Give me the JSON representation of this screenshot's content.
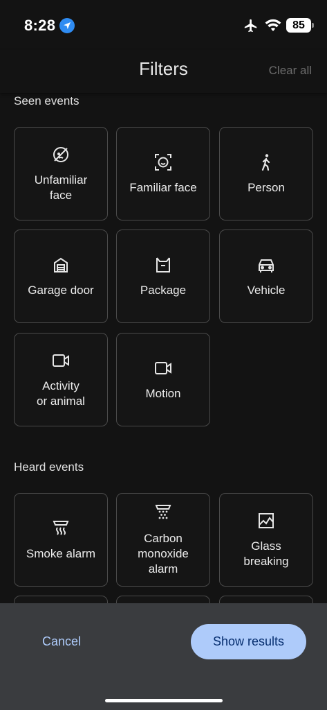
{
  "status": {
    "time": "8:28",
    "battery": "85",
    "icons": [
      "location-icon",
      "airplane-icon",
      "wifi-icon",
      "battery-icon"
    ]
  },
  "header": {
    "title": "Filters",
    "clear_all": "Clear all"
  },
  "seen": {
    "title": "Seen events",
    "items": [
      {
        "label": "Unfamiliar\nface",
        "icon": "unfamiliar-face-icon"
      },
      {
        "label": "Familiar face",
        "icon": "familiar-face-icon"
      },
      {
        "label": "Person",
        "icon": "person-walking-icon"
      },
      {
        "label": "Garage door",
        "icon": "garage-icon"
      },
      {
        "label": "Package",
        "icon": "package-icon"
      },
      {
        "label": "Vehicle",
        "icon": "car-icon"
      },
      {
        "label": "Activity\nor animal",
        "icon": "video-camera-icon"
      },
      {
        "label": "Motion",
        "icon": "video-camera-icon"
      }
    ]
  },
  "heard": {
    "title": "Heard events",
    "items": [
      {
        "label": "Smoke alarm",
        "icon": "smoke-alarm-icon"
      },
      {
        "label": "Carbon\nmonoxide\nalarm",
        "icon": "co-alarm-icon"
      },
      {
        "label": "Glass\nbreaking",
        "icon": "glass-breaking-icon"
      }
    ]
  },
  "footer": {
    "cancel": "Cancel",
    "show_results": "Show results"
  },
  "colors": {
    "background": "#131313",
    "tile_border": "#4a4a4a",
    "accent": "#aecbfa",
    "sheet": "#3a3c3f"
  }
}
